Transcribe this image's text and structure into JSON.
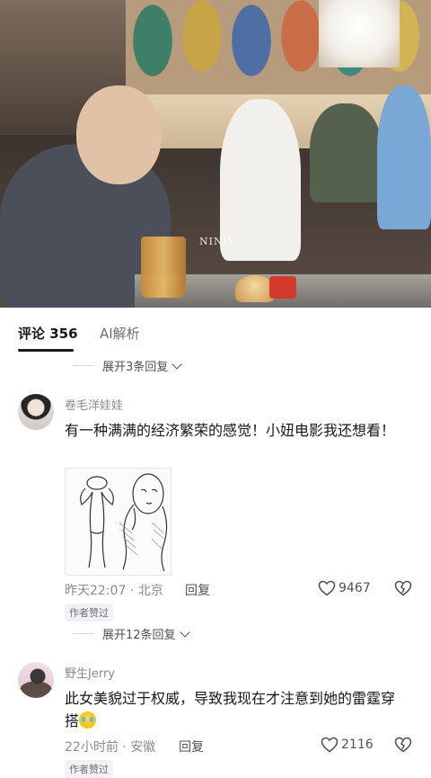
{
  "video": {
    "watermark": "NINIV"
  },
  "tabs": [
    {
      "label": "评论 356",
      "active": true
    },
    {
      "label": "AI解析",
      "active": false
    }
  ],
  "expand_rows": [
    {
      "label": "展开3条回复"
    },
    {
      "label": "展开12条回复"
    }
  ],
  "comments": [
    {
      "username": "卷毛洋娃娃",
      "text": "有一种满满的经济繁荣的感觉！小妞电影我还想看！",
      "time": "昨天22:07",
      "location": "北京",
      "reply_label": "回复",
      "likes": "9467",
      "badge": "作者赞过",
      "has_image": true
    },
    {
      "username": "野生Jerry",
      "text": "此女美貌过于权威，导致我现在才注意到她的雷霆穿搭",
      "emoji": "crying-laughing-emoji",
      "time": "22小时前",
      "location": "安徽",
      "reply_label": "回复",
      "likes": "2116",
      "badge": "作者赞过"
    }
  ],
  "separator": " · ",
  "colors": {
    "text_primary": "#161823",
    "text_secondary": "#8a8b91",
    "background": "#ffffff"
  }
}
